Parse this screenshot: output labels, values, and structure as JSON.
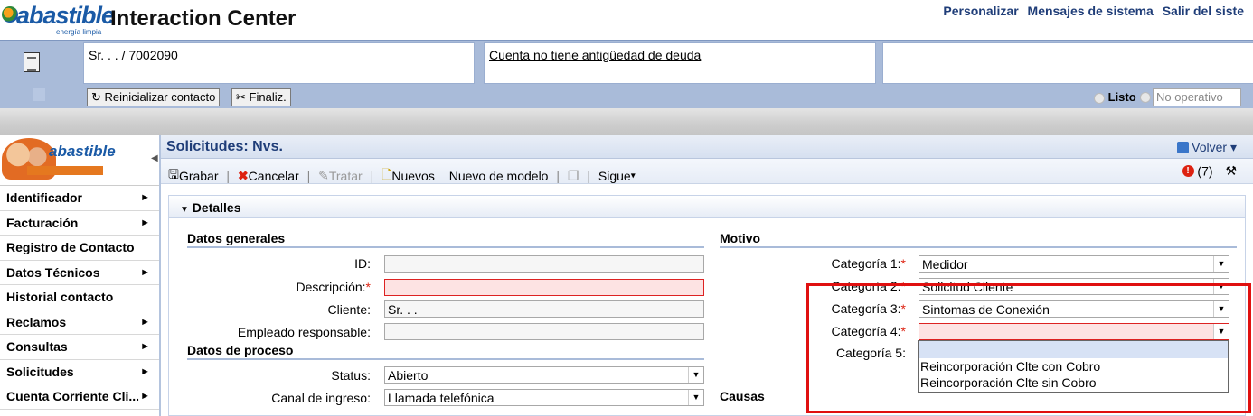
{
  "header": {
    "brand": "abastible",
    "brand_tagline": "energía limpia",
    "app_title": "Interaction Center",
    "links": [
      "Personalizar",
      "Mensajes de sistema",
      "Salir del siste"
    ]
  },
  "contact_bar": {
    "customer": "Sr. . . / 7002090",
    "debt_status": "Cuenta no tiene antigüedad de deuda",
    "reset_button": "Reinicializar contacto",
    "end_button": "Finaliz.",
    "status_ready": "Listo",
    "status_not_operative": "No operativo"
  },
  "left_nav": {
    "brand": "abastible",
    "items": [
      {
        "label": "Identificador",
        "has_arrow": true
      },
      {
        "label": "Facturación",
        "has_arrow": true
      },
      {
        "label": "Registro de Contacto",
        "has_arrow": false
      },
      {
        "label": "Datos Técnicos",
        "has_arrow": true
      },
      {
        "label": "Historial contacto",
        "has_arrow": false
      },
      {
        "label": "Reclamos",
        "has_arrow": true
      },
      {
        "label": "Consultas",
        "has_arrow": true
      },
      {
        "label": "Solicitudes",
        "has_arrow": true
      },
      {
        "label": "Cuenta Corriente Cli...",
        "has_arrow": true
      }
    ]
  },
  "main": {
    "title": "Solicitudes: Nvs.",
    "back": "Volver",
    "toolbar": {
      "save": "Grabar",
      "cancel": "Cancelar",
      "process": "Tratar",
      "new": "Nuevos",
      "new_from_template": "Nuevo de modelo",
      "next": "Sigue"
    },
    "messages_count": "(7)",
    "details": {
      "label": "Detalles",
      "general_section": "Datos generales",
      "process_section": "Datos de proceso",
      "motive_section": "Motivo",
      "causes_section": "Causas",
      "fields": {
        "id_label": "ID:",
        "id_value": "",
        "description_label": "Descripción:",
        "description_value": "",
        "client_label": "Cliente:",
        "client_value": "Sr. . .",
        "employee_label": "Empleado responsable:",
        "employee_value": "",
        "status_label": "Status:",
        "status_value": "Abierto",
        "channel_label": "Canal de ingreso:",
        "channel_value": "Llamada telefónica"
      },
      "motive": {
        "cat1_label": "Categoría 1:",
        "cat1_value": "Medidor",
        "cat2_label": "Categoría 2:",
        "cat2_value": "Solicitud Cliente",
        "cat3_label": "Categoría 3:",
        "cat3_value": "Sintomas de Conexión",
        "cat4_label": "Categoría 4:",
        "cat4_value": "",
        "cat5_label": "Categoría 5:"
      },
      "cat4_options": [
        "",
        "Reincorporación Clte con Cobro",
        "Reincorporación Clte sin Cobro"
      ]
    }
  },
  "colors": {
    "brand_blue": "#1a5aa6",
    "bar_blue": "#a9bbd9",
    "error_red": "#dd2222",
    "highlight_red": "#e01010"
  }
}
